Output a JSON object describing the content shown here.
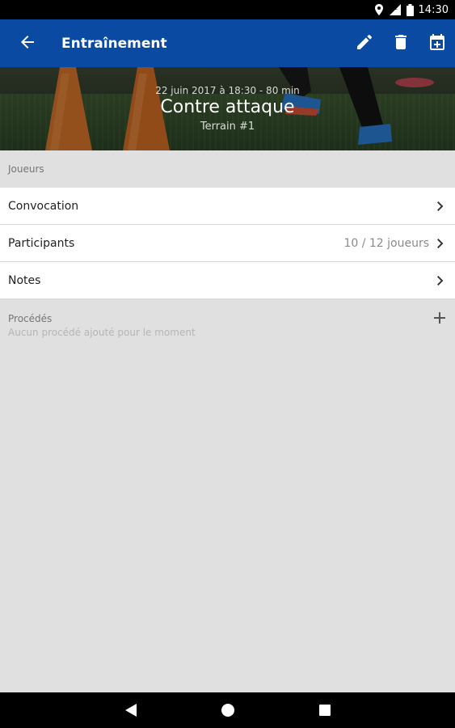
{
  "status_bar": {
    "time": "14:30",
    "icons": [
      "location-icon",
      "signal-icon",
      "battery-icon"
    ]
  },
  "app_bar": {
    "title": "Entraînement",
    "background": "#0b4aa2",
    "actions": [
      "edit-icon",
      "delete-icon",
      "calendar-add-icon"
    ]
  },
  "hero": {
    "date": "22 juin 2017 à 18:30 - 80 min",
    "title": "Contre attaque",
    "field": "Terrain #1"
  },
  "players_section": {
    "header": "Joueurs",
    "rows": [
      {
        "label": "Convocation",
        "value": ""
      },
      {
        "label": "Participants",
        "value": "10 / 12 joueurs"
      },
      {
        "label": "Notes",
        "value": ""
      }
    ]
  },
  "procedures_section": {
    "header": "Procédés",
    "empty_text": "Aucun procédé ajouté pour le moment"
  },
  "nav_bar": {
    "buttons": [
      "back-triangle-icon",
      "home-circle-icon",
      "recents-square-icon"
    ]
  }
}
